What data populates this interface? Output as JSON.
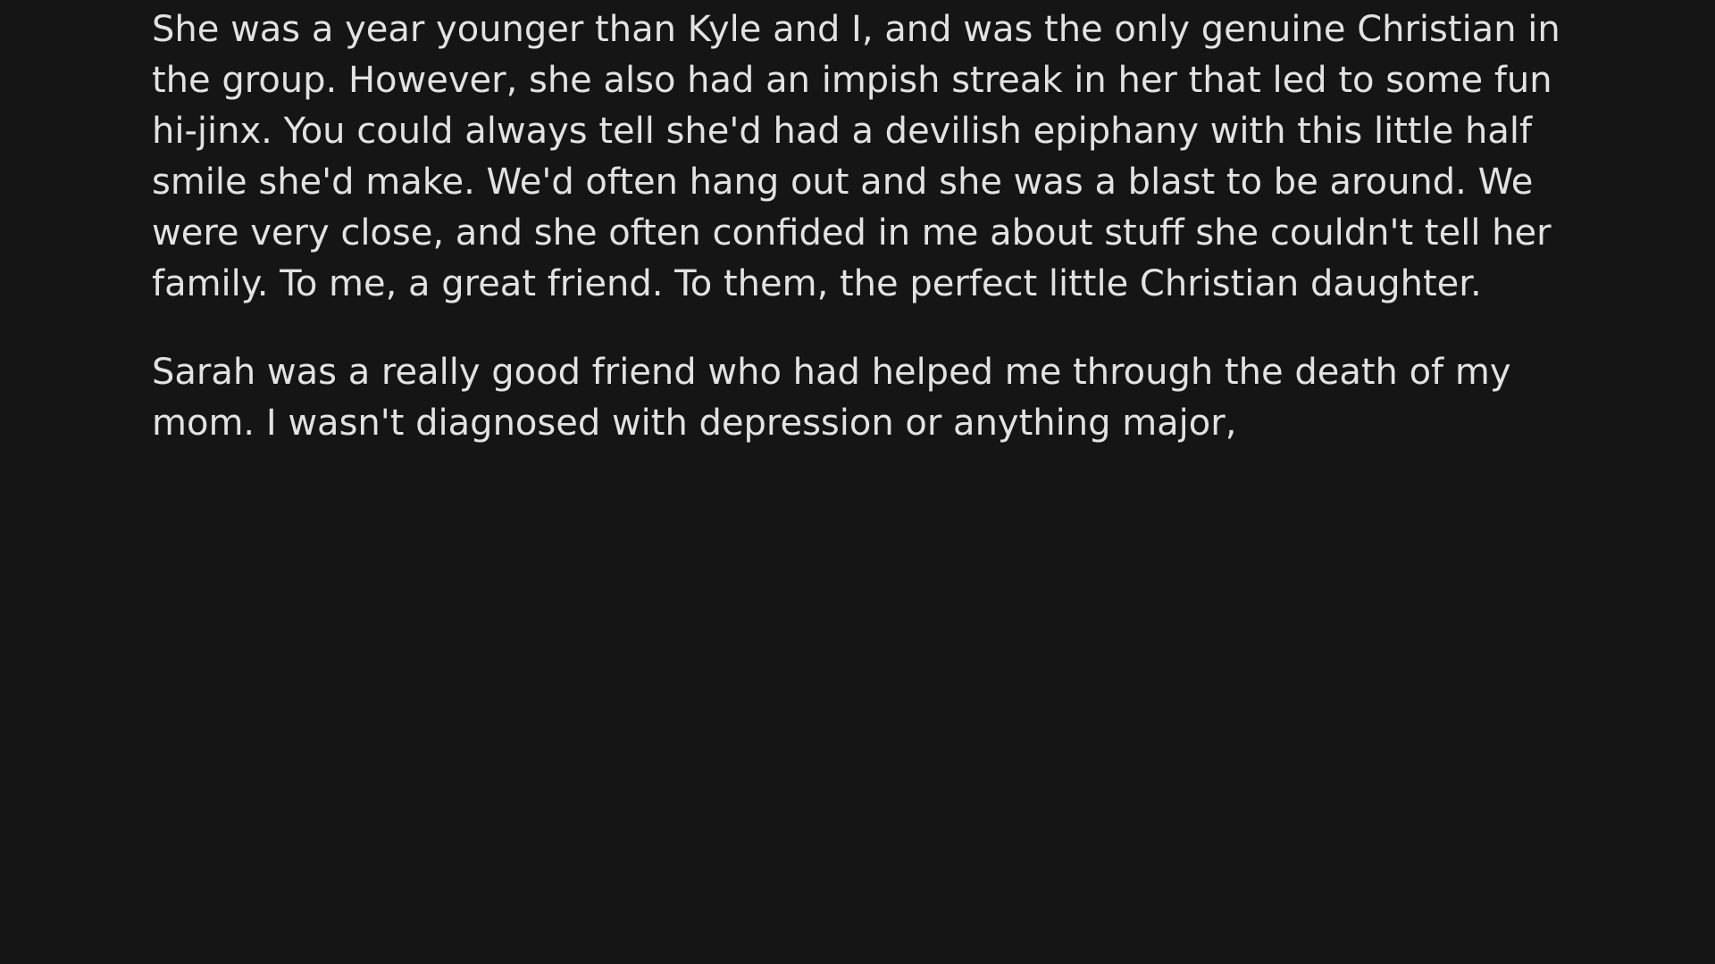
{
  "paragraphs": [
    {
      "lines": [
        "She was a year younger than Kyle and I, and was the only genuine Christian in",
        "the group. However, she also had an impish streak in her that led to some fun",
        "hi-jinx. You could always tell she'd had a devilish epiphany with this little half",
        "smile she'd make. We'd often hang out and she was a blast to be around. We",
        "were very close, and she often confided in me about stuff she couldn't tell her",
        "family. To me, a great friend. To them, the perfect little Christian daughter."
      ]
    },
    {
      "lines": [
        "Sarah was a really good friend who had helped me through the death of my",
        "mom. I wasn't diagnosed with depression or anything major,"
      ]
    }
  ]
}
